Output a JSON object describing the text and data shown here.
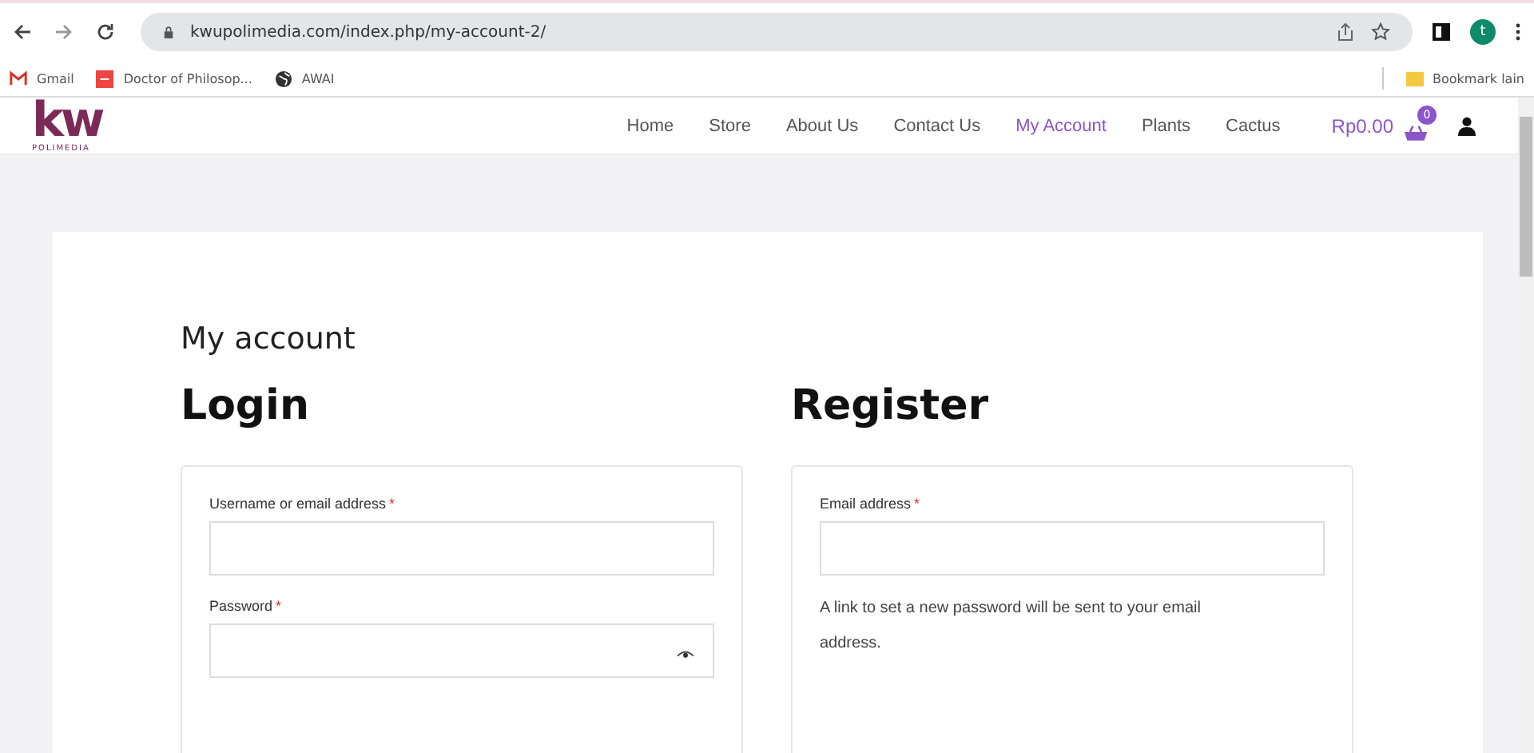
{
  "browser": {
    "url": "kwupolimedia.com/index.php/my-account-2/",
    "profile_initial": "t",
    "bookmarks": [
      {
        "label": "Gmail",
        "kind": "gmail"
      },
      {
        "label": "Doctor of Philosop...",
        "kind": "doc"
      },
      {
        "label": "AWAI",
        "kind": "globe"
      }
    ],
    "other_bookmarks": "Bookmark lain"
  },
  "site": {
    "logo": {
      "mark": "kw",
      "sub": "POLIMEDIA"
    },
    "nav": [
      {
        "label": "Home",
        "selected": false
      },
      {
        "label": "Store",
        "selected": false
      },
      {
        "label": "About Us",
        "selected": false
      },
      {
        "label": "Contact Us",
        "selected": false
      },
      {
        "label": "My Account",
        "selected": true
      },
      {
        "label": "Plants",
        "selected": false
      },
      {
        "label": "Cactus",
        "selected": false
      }
    ],
    "cart": {
      "total": "Rp0.00",
      "count": "0"
    }
  },
  "page": {
    "title": "My account",
    "login": {
      "heading": "Login",
      "fields": [
        {
          "label": "Username or email address",
          "required_mark": "*",
          "reveal_toggle": false
        },
        {
          "label": "Password",
          "required_mark": "*",
          "reveal_toggle": true
        }
      ]
    },
    "register": {
      "heading": "Register",
      "fields": [
        {
          "label": "Email address",
          "required_mark": "*",
          "reveal_toggle": false
        }
      ],
      "note": "A link to set a new password will be sent to your email address."
    }
  }
}
